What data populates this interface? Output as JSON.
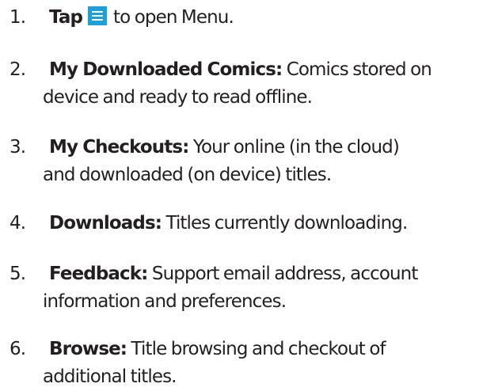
{
  "steps": [
    {
      "number": "1.",
      "term": "Tap",
      "icon": "menu-icon",
      "icon_color": "#1ba0dc",
      "description": "to open Menu."
    },
    {
      "number": "2.",
      "term": "My Downloaded Comics:",
      "description_line1": "Comics stored on",
      "description_line2": "device and ready to read offline."
    },
    {
      "number": "3.",
      "term": "My Checkouts:",
      "description_line1": "Your online (in the cloud)",
      "description_line2": "and downloaded (on device) titles."
    },
    {
      "number": "4.",
      "term": "Downloads:",
      "description_line1": "Titles currently downloading."
    },
    {
      "number": "5.",
      "term": "Feedback:",
      "description_line1": "Support email address, account",
      "description_line2": "information and preferences."
    },
    {
      "number": "6.",
      "term": "Browse:",
      "description_line1": "Title browsing and checkout of",
      "description_line2": "additional titles."
    }
  ]
}
